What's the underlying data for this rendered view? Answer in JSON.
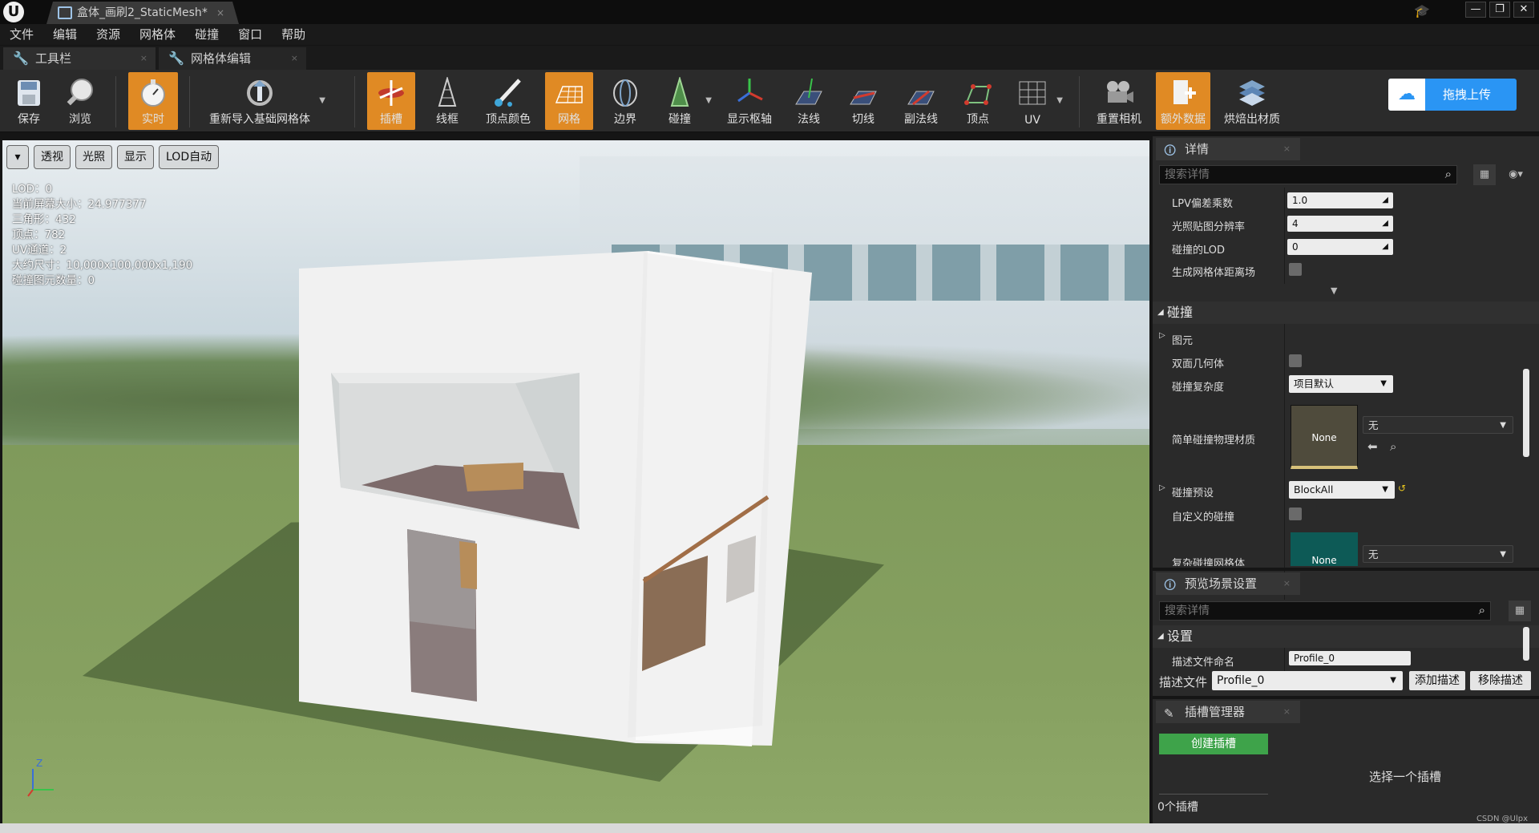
{
  "window": {
    "doc_tab": "盒体_画刷2_StaticMesh",
    "tab_dirty": "*",
    "close_x": "×",
    "min": "—",
    "restore": "❐",
    "close": "✕"
  },
  "menu": [
    "文件",
    "编辑",
    "资源",
    "网格体",
    "碰撞",
    "窗口",
    "帮助"
  ],
  "panel_tabs": [
    "工具栏",
    "网格体编辑"
  ],
  "toolbar": {
    "buttons": [
      {
        "label": "保存",
        "icon": "save-icon",
        "active": false
      },
      {
        "label": "浏览",
        "icon": "browse-icon",
        "active": false
      },
      {
        "label": "实时",
        "icon": "stopwatch-icon",
        "active": true
      },
      {
        "label": "重新导入基础网格体",
        "icon": "reimport-icon",
        "active": false
      },
      {
        "label": "插槽",
        "icon": "socket-icon",
        "active": true
      },
      {
        "label": "线框",
        "icon": "wireframe-icon",
        "active": false
      },
      {
        "label": "顶点颜色",
        "icon": "vertex-color-icon",
        "active": false
      },
      {
        "label": "网格",
        "icon": "grid-icon",
        "active": true
      },
      {
        "label": "边界",
        "icon": "bounds-icon",
        "active": false
      },
      {
        "label": "碰撞",
        "icon": "collision-icon",
        "active": false
      },
      {
        "label": "显示枢轴",
        "icon": "pivot-icon",
        "active": false
      },
      {
        "label": "法线",
        "icon": "normals-icon",
        "active": false
      },
      {
        "label": "切线",
        "icon": "tangents-icon",
        "active": false
      },
      {
        "label": "副法线",
        "icon": "binormals-icon",
        "active": false
      },
      {
        "label": "顶点",
        "icon": "vertices-icon",
        "active": false
      },
      {
        "label": "UV",
        "icon": "uv-icon",
        "active": false
      },
      {
        "label": "重置相机",
        "icon": "camera-icon",
        "active": false
      },
      {
        "label": "额外数据",
        "icon": "extra-data-icon",
        "active": true
      },
      {
        "label": "烘焙出材质",
        "icon": "bake-material-icon",
        "active": false
      }
    ],
    "upload_label": "拖拽上传"
  },
  "viewport": {
    "toolbar": [
      "透视",
      "光照",
      "显示",
      "LOD自动"
    ],
    "stats": [
      "LOD：0",
      "当前屏幕大小：24.977377",
      "三角形：432",
      "顶点：782",
      "UV通道：2",
      "大约尺寸：10,000x100,000x1,190",
      "碰撞图元数量：0"
    ],
    "axis_label": "Z"
  },
  "details": {
    "tab_label": "详情",
    "search_placeholder": "搜索详情",
    "rows_top": [
      {
        "label": "LPV偏差乘数",
        "value": "1.0"
      },
      {
        "label": "光照贴图分辨率",
        "value": "4"
      },
      {
        "label": "碰撞的LOD",
        "value": "0"
      },
      {
        "label": "生成网格体距离场",
        "value": ""
      }
    ],
    "collision_section": "碰撞",
    "primitives_label": "图元",
    "double_sided_label": "双面几何体",
    "complexity_label": "碰撞复杂度",
    "complexity_value": "项目默认",
    "simple_phys_label": "简单碰撞物理材质",
    "none_label": "None",
    "none_dropdown": "无",
    "preset_label": "碰撞预设",
    "preset_value": "BlockAll",
    "custom_label": "自定义的碰撞",
    "complex_mesh_label": "复杂碰撞网格体"
  },
  "preview": {
    "tab_label": "预览场景设置",
    "search_placeholder": "搜索详情",
    "section": "设置",
    "profile_name_label": "描述文件命名",
    "profile_name_value": "Profile_0",
    "profile_label": "描述文件",
    "profile_value": "Profile_0",
    "add_btn": "添加描述",
    "remove_btn": "移除描述"
  },
  "sockets": {
    "tab_label": "插槽管理器",
    "create_btn": "创建插槽",
    "hint": "选择一个插槽",
    "count": "0个插槽"
  },
  "watermark": "CSDN @Ulpx"
}
